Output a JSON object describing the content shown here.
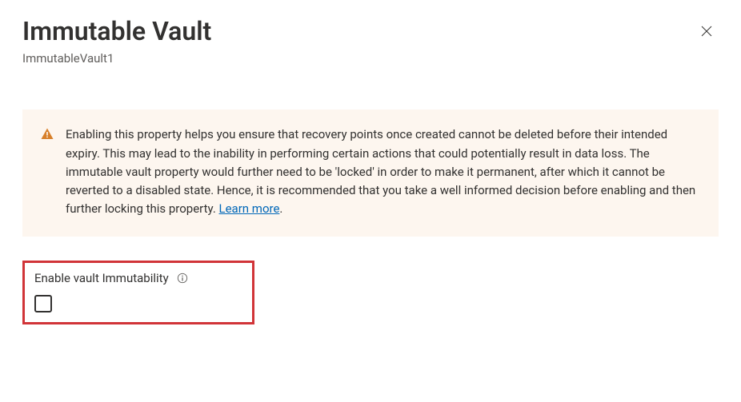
{
  "header": {
    "title": "Immutable Vault",
    "subtitle": "ImmutableVault1"
  },
  "warning": {
    "text": "Enabling this property helps you ensure that recovery points once created cannot be deleted before their intended expiry. This may lead to the inability in performing certain actions that could potentially result in data loss. The immutable vault property would further need to be 'locked' in order to make it permanent, after which it cannot be reverted to a disabled state. Hence, it is recommended that you take a well informed decision before enabling and then further locking this property. ",
    "learn_more": "Learn more"
  },
  "form": {
    "checkbox_label": "Enable vault Immutability"
  }
}
